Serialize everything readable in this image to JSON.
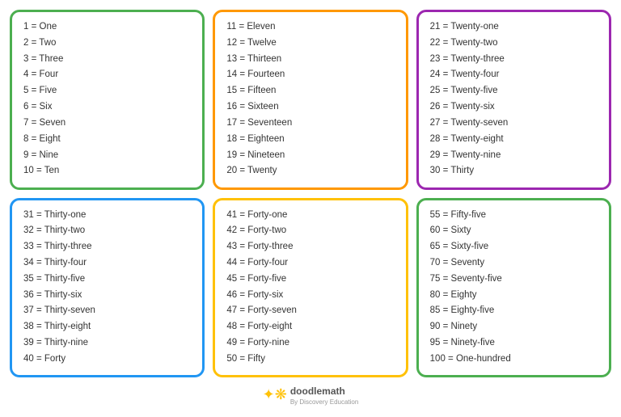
{
  "cards": [
    {
      "id": "card-1",
      "color": "green",
      "items": [
        "1 = One",
        "2 = Two",
        "3 = Three",
        "4 = Four",
        "5 = Five",
        "6 = Six",
        "7 = Seven",
        "8 = Eight",
        "9 = Nine",
        "10 = Ten"
      ]
    },
    {
      "id": "card-2",
      "color": "orange",
      "items": [
        "11 = Eleven",
        "12 = Twelve",
        "13 = Thirteen",
        "14 = Fourteen",
        "15 = Fifteen",
        "16 = Sixteen",
        "17 = Seventeen",
        "18 = Eighteen",
        "19 = Nineteen",
        "20 = Twenty"
      ]
    },
    {
      "id": "card-3",
      "color": "purple",
      "items": [
        "21 = Twenty-one",
        "22 = Twenty-two",
        "23 = Twenty-three",
        "24 = Twenty-four",
        "25 = Twenty-five",
        "26 = Twenty-six",
        "27 = Twenty-seven",
        "28 = Twenty-eight",
        "29 = Twenty-nine",
        "30 = Thirty"
      ]
    },
    {
      "id": "card-4",
      "color": "blue",
      "items": [
        "31 = Thirty-one",
        "32 = Thirty-two",
        "33 = Thirty-three",
        "34 = Thirty-four",
        "35 = Thirty-five",
        "36 = Thirty-six",
        "37 = Thirty-seven",
        "38 = Thirty-eight",
        "39 = Thirty-nine",
        "40 = Forty"
      ]
    },
    {
      "id": "card-5",
      "color": "yellow",
      "items": [
        "41 = Forty-one",
        "42 = Forty-two",
        "43 = Forty-three",
        "44 = Forty-four",
        "45 = Forty-five",
        "46 = Forty-six",
        "47 = Forty-seven",
        "48 = Forty-eight",
        "49 = Forty-nine",
        "50 = Fifty"
      ]
    },
    {
      "id": "card-6",
      "color": "green2",
      "items": [
        "55 = Fifty-five",
        "60 = Sixty",
        "65 = Sixty-five",
        "70 = Seventy",
        "75 = Seventy-five",
        "80 = Eighty",
        "85 = Eighty-five",
        "90 = Ninety",
        "95 = Ninety-five",
        "100 = One-hundred"
      ]
    }
  ],
  "footer": {
    "brand": "doodlemath",
    "sub": "By Discovery Education"
  }
}
